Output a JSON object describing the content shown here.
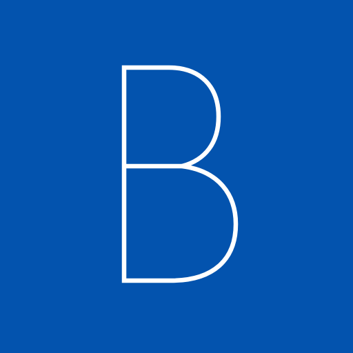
{
  "logo": {
    "glyph": "B",
    "colors": {
      "background": "#0353AE",
      "glyph_stroke": "#FFFFFF"
    }
  }
}
